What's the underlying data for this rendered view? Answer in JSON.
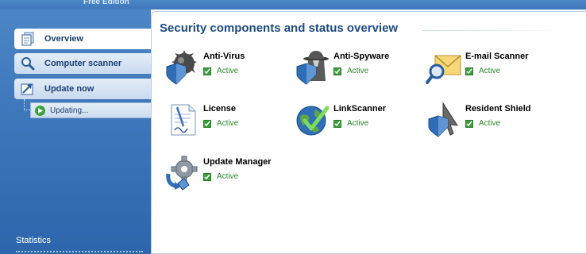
{
  "header": {
    "edition": "Free Edition"
  },
  "sidebar": {
    "items": [
      {
        "label": "Overview",
        "icon": "document-icon",
        "selected": true
      },
      {
        "label": "Computer scanner",
        "icon": "magnifier-icon",
        "selected": false
      },
      {
        "label": "Update now",
        "icon": "update-arrow-icon",
        "selected": false
      }
    ],
    "subitem": {
      "label": "Updating...",
      "icon": "play-icon"
    },
    "statistics_label": "Statistics"
  },
  "main": {
    "title": "Security components and status overview",
    "components": [
      {
        "name": "Anti-Virus",
        "status": "Active",
        "icon": "antivirus-shield-icon"
      },
      {
        "name": "Anti-Spyware",
        "status": "Active",
        "icon": "spy-shield-icon"
      },
      {
        "name": "E-mail Scanner",
        "status": "Active",
        "icon": "envelope-magnifier-icon"
      },
      {
        "name": "License",
        "status": "Active",
        "icon": "license-document-icon"
      },
      {
        "name": "LinkScanner",
        "status": "Active",
        "icon": "globe-check-icon"
      },
      {
        "name": "Resident Shield",
        "status": "Active",
        "icon": "cursor-shield-icon"
      },
      {
        "name": "Update Manager",
        "status": "Active",
        "icon": "gear-update-icon"
      }
    ]
  },
  "colors": {
    "sidebar_blue": "#3f78bb",
    "title_blue": "#1d4a86",
    "status_green": "#2a8a2a"
  }
}
